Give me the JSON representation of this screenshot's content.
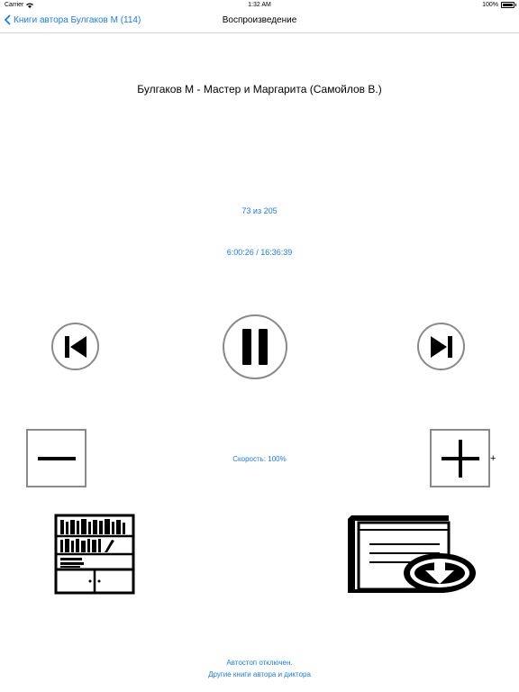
{
  "status_bar": {
    "carrier": "Carrier",
    "time": "1:32 AM",
    "battery": "100%"
  },
  "nav": {
    "back_label": "Книги автора Булгаков М (114)",
    "title": "Воспроизведение"
  },
  "player": {
    "book_title": "Булгаков М - Мастер и Маргарита (Самойлов В.)",
    "chapter": "73 из 205",
    "time_position": "6:00:26 / 16:36:39",
    "speed_label": "Скорость: 100%",
    "speed_plus_suffix": "+"
  },
  "footer": {
    "autostop": "Автостоп отключен.",
    "other_books": "Другие книги автора и диктора"
  },
  "icons": {
    "back": "chevron-left-icon",
    "previous": "skip-previous-icon",
    "pause": "pause-icon",
    "next": "skip-next-icon",
    "minus": "minus-icon",
    "plus": "plus-icon",
    "bookshelf": "bookshelf-icon",
    "download": "download-book-icon"
  },
  "colors": {
    "accent": "#1a7cf5",
    "button_border": "#8a8a8a"
  }
}
